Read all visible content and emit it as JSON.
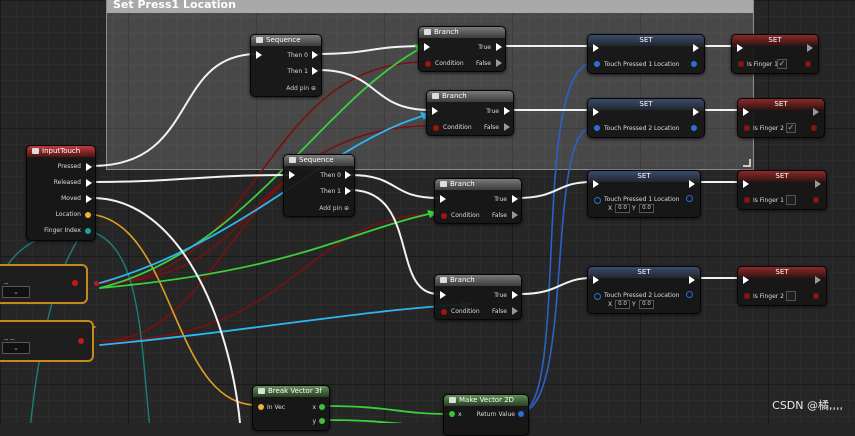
{
  "comment": {
    "title": "Set Press1 Location"
  },
  "nodes": {
    "inputtouch": {
      "title": "InputTouch",
      "pins": [
        "Pressed",
        "Released",
        "Moved",
        "Location",
        "Finger Index"
      ]
    },
    "seq1": {
      "title": "Sequence",
      "then0": "Then 0",
      "then1": "Then 1",
      "add": "Add pin ⊕"
    },
    "seq2": {
      "title": "Sequence",
      "then0": "Then 0",
      "then1": "Then 1",
      "add": "Add pin ⊕"
    },
    "branch1": {
      "title": "Branch",
      "true": "True",
      "false": "False",
      "condition": "Condition"
    },
    "branch2": {
      "title": "Branch",
      "true": "True",
      "false": "False",
      "condition": "Condition"
    },
    "branch3": {
      "title": "Branch",
      "true": "True",
      "false": "False",
      "condition": "Condition"
    },
    "branch4": {
      "title": "Branch",
      "true": "True",
      "false": "False",
      "condition": "Condition"
    },
    "set1": {
      "title": "SET",
      "var": "Touch Pressed 1 Location"
    },
    "set2": {
      "title": "SET",
      "var": "Touch Pressed 2 Location"
    },
    "set3": {
      "title": "SET",
      "var": "Touch Pressed 1 Location",
      "x": "0.0",
      "y": "0.0",
      "xl": "X",
      "yl": "Y"
    },
    "set4": {
      "title": "SET",
      "var": "Touch Pressed 2 Location",
      "x": "0.0",
      "y": "0.0",
      "xl": "X",
      "yl": "Y"
    },
    "setb1": {
      "title": "SET",
      "var": "Is Finger 1",
      "checked": "✓"
    },
    "setb2": {
      "title": "SET",
      "var": "Is Finger 2",
      "checked": "✓"
    },
    "setb3": {
      "title": "SET",
      "var": "Is Finger 1"
    },
    "setb4": {
      "title": "SET",
      "var": "Is Finger 2"
    },
    "breakvec": {
      "title": "Break Vector 3f",
      "in": "In Vec",
      "x": "x",
      "y": "y"
    },
    "makevec": {
      "title": "Make Vector 2D",
      "x": "x",
      "ret": "Return Value"
    },
    "var1": {
      "dots": "--"
    },
    "var2": {
      "dots": "-- --"
    }
  },
  "watermark": "CSDN @橘,,,,",
  "colors": {
    "exec": "#ffffff",
    "bool": "#8c1212",
    "vector": "#f0b030",
    "vector2d": "#2a6fd6",
    "float": "#3ac23a",
    "int": "#1ea098",
    "struct": "#36b8f4"
  }
}
